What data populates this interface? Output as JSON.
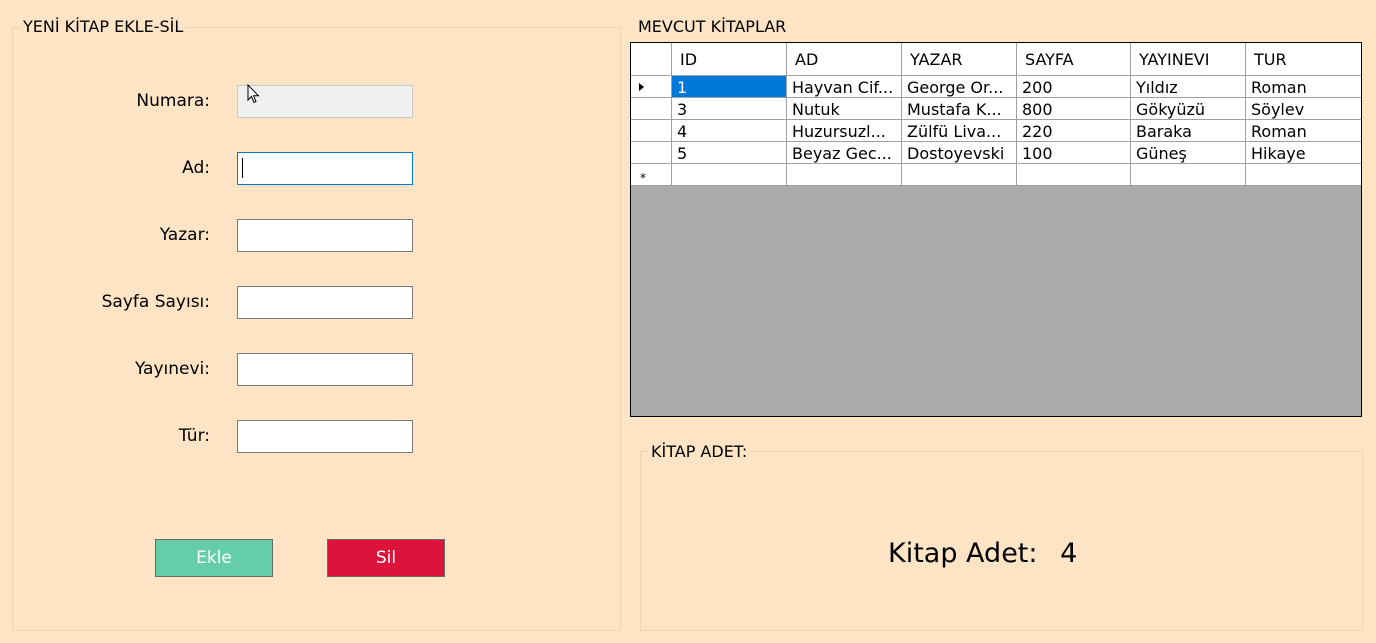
{
  "left_group": {
    "title": "YENİ KİTAP EKLE-SİL",
    "fields": [
      {
        "label": "Numara:",
        "value": ""
      },
      {
        "label": "Ad:",
        "value": ""
      },
      {
        "label": "Yazar:",
        "value": ""
      },
      {
        "label": "Sayfa Sayısı:",
        "value": ""
      },
      {
        "label": "Yayınevi:",
        "value": ""
      },
      {
        "label": "Tür:",
        "value": ""
      }
    ],
    "add_button": "Ekle",
    "delete_button": "Sil"
  },
  "books_group": {
    "title": "MEVCUT KİTAPLAR",
    "columns": [
      "ID",
      "AD",
      "YAZAR",
      "SAYFA",
      "YAYINEVI",
      "TUR"
    ],
    "rows": [
      [
        "1",
        "Hayvan Cif...",
        "George Or...",
        "200",
        "Yıldız",
        "Roman"
      ],
      [
        "3",
        "Nutuk",
        "Mustafa K...",
        "800",
        "Gökyüzü",
        "Söylev"
      ],
      [
        "4",
        "Huzursuzl...",
        "Zülfü Liva...",
        "220",
        "Baraka",
        "Roman"
      ],
      [
        "5",
        "Beyaz Gec...",
        "Dostoyevski",
        "100",
        "Güneş",
        "Hikaye"
      ]
    ],
    "new_row_marker": "*"
  },
  "count_group": {
    "title": "KİTAP ADET:",
    "count_label": "Kitap Adet:",
    "count_value": "4"
  },
  "colors": {
    "background": "#fde4c4",
    "add_button": "#66cdaa",
    "delete_button": "#dc143c",
    "selection": "#0078d7",
    "grid_empty": "#ababab"
  },
  "icons": {
    "cursor": "mouse-pointer-icon",
    "current_row": "row-arrow-icon"
  }
}
